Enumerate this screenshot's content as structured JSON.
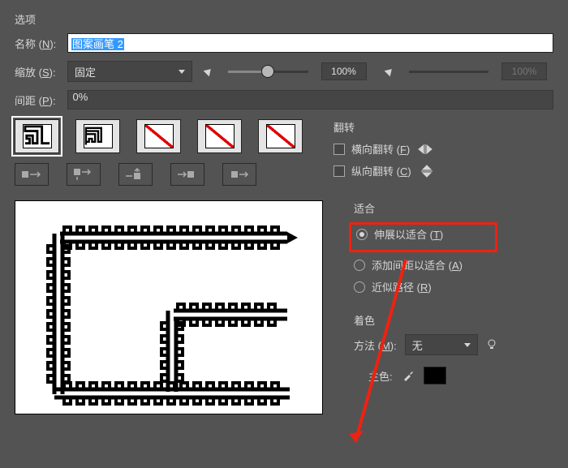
{
  "options_label": "选项",
  "name": {
    "label": "名称 (N):",
    "value": "图案画笔 2"
  },
  "scale": {
    "label": "缩放 (S):",
    "mode": "固定",
    "value": "100%",
    "value2": "100%"
  },
  "spacing": {
    "label": "间距 (P):",
    "value": "0%"
  },
  "flip": {
    "title": "翻转",
    "horizontal": "横向翻转 (F)",
    "vertical": "纵向翻转 (C)",
    "horizontal_checked": false,
    "vertical_checked": false
  },
  "fit": {
    "title": "适合",
    "stretch": "伸展以适合 (T)",
    "addspace": "添加间距以适合 (A)",
    "approx": "近似路径 (R)",
    "selected": "stretch"
  },
  "colorize": {
    "title": "着色",
    "method_label": "方法 (M):",
    "method_value": "无",
    "keycolor_label": "主色:"
  }
}
